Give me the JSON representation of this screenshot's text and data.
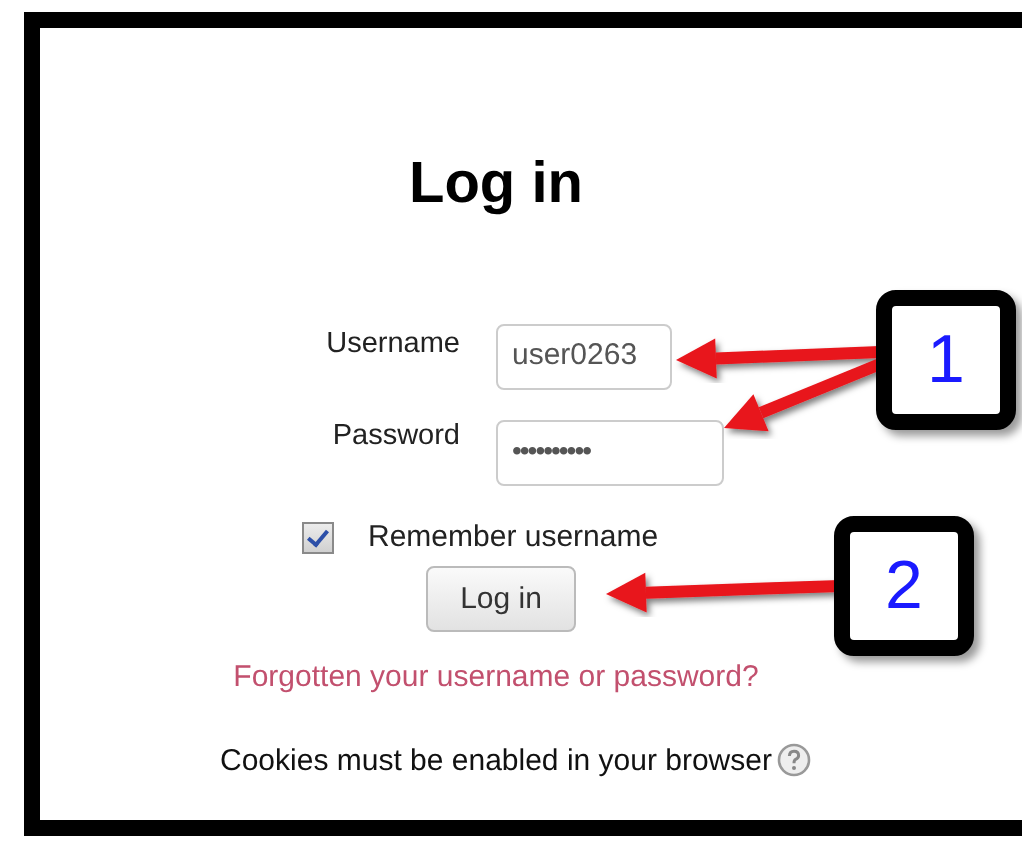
{
  "title": "Log in",
  "fields": [
    {
      "label": "Username",
      "value": "user0263",
      "kind": "text"
    },
    {
      "label": "Password",
      "value": "••••••••••",
      "kind": "password"
    }
  ],
  "remember": {
    "label": "Remember username",
    "checked": true
  },
  "button": "Log in",
  "forgot_link": "Forgotten your username or password?",
  "cookies_note": "Cookies must be enabled in your browser",
  "callouts": [
    {
      "number": "1"
    },
    {
      "number": "2"
    }
  ]
}
